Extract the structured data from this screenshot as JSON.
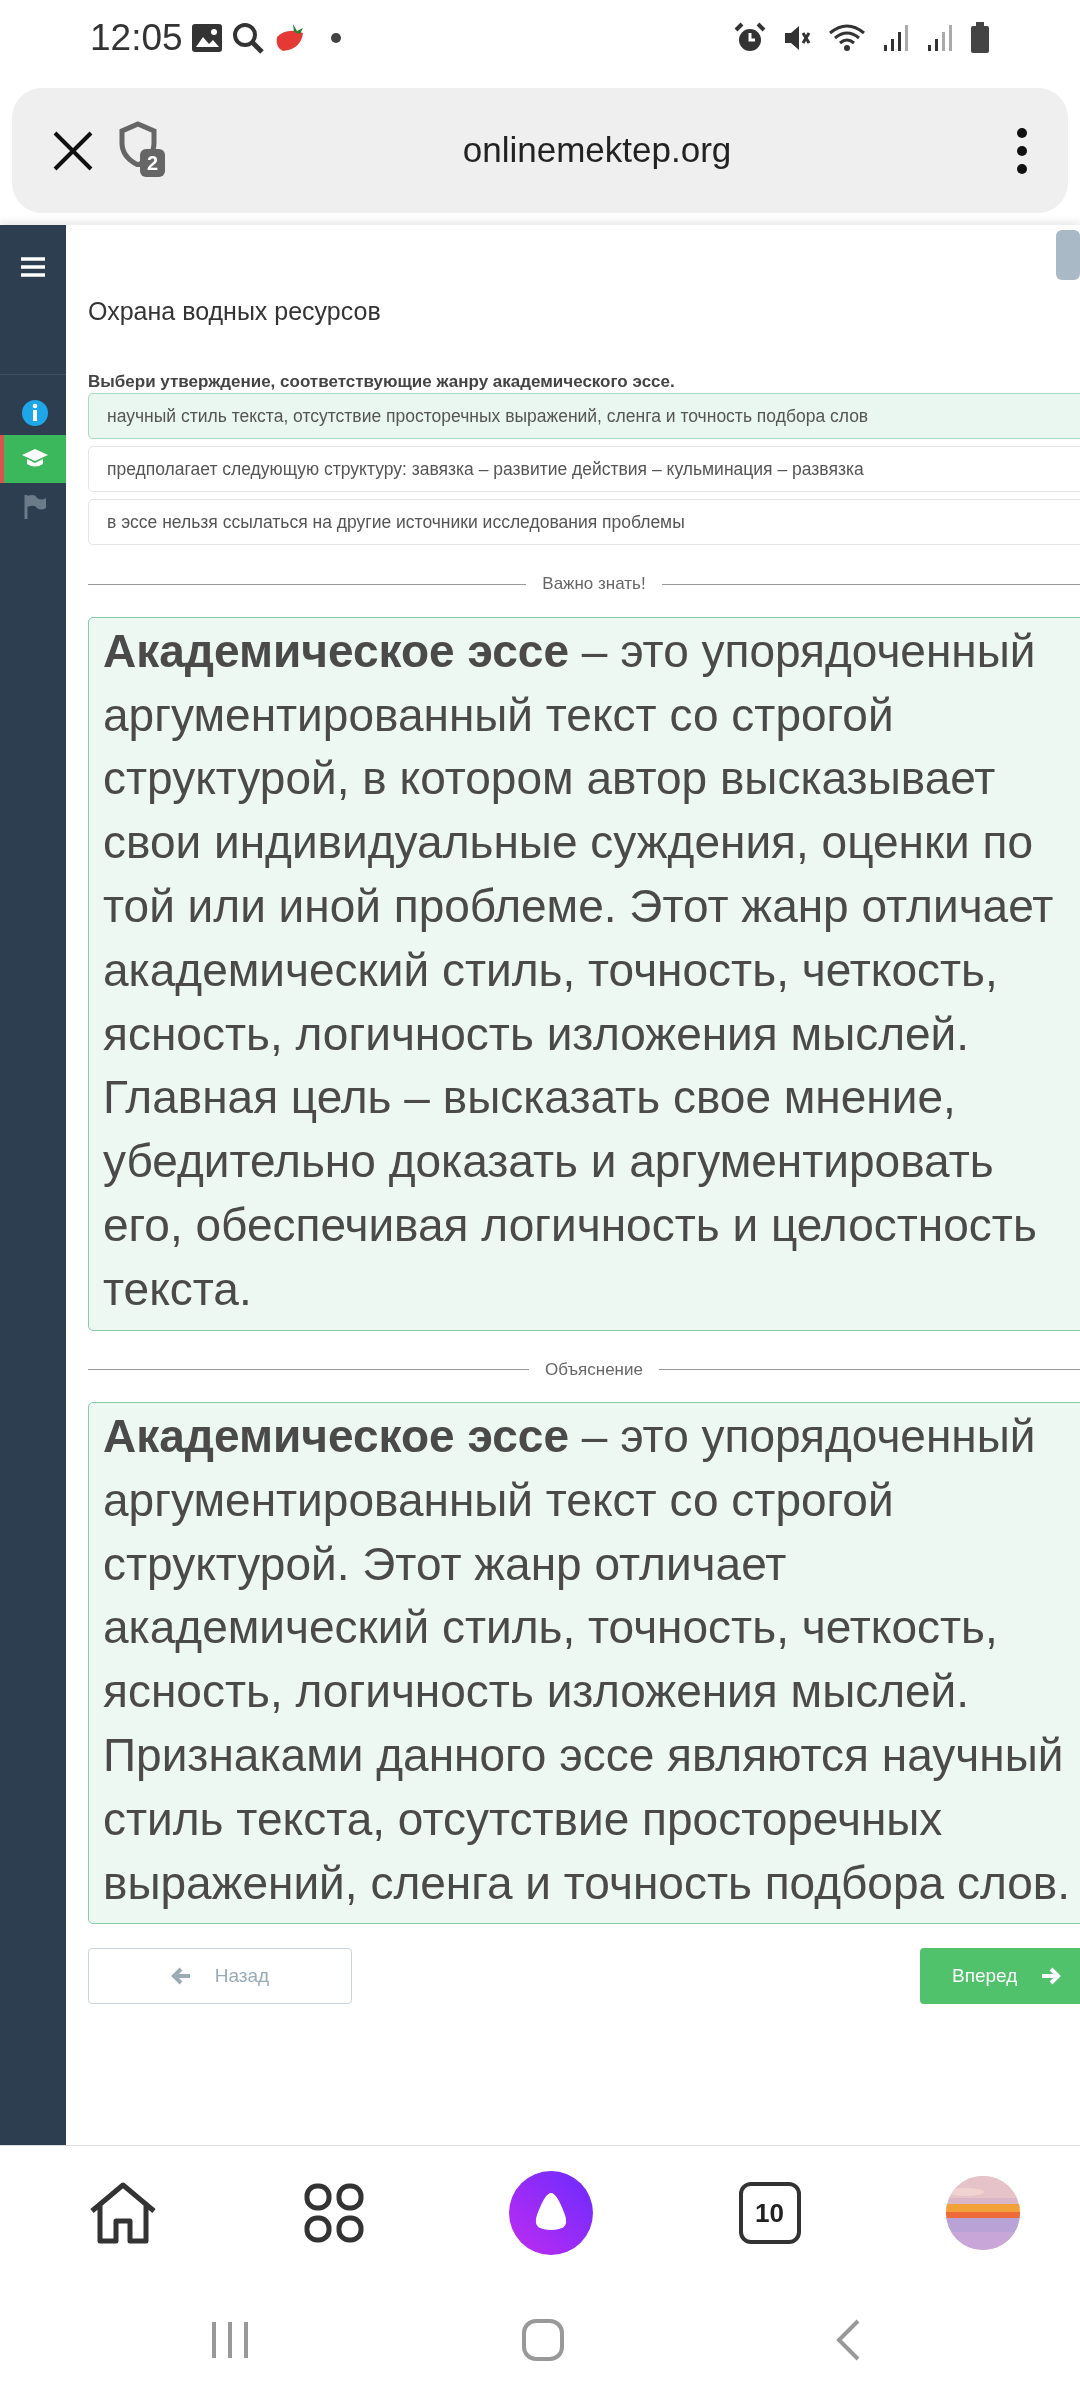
{
  "status_bar": {
    "time": "12:05"
  },
  "browser": {
    "url": "onlinemektep.org",
    "tab_badge": "2"
  },
  "sidebar": {
    "items": [
      {
        "kind": "info",
        "selected": false
      },
      {
        "kind": "course",
        "selected": true
      },
      {
        "kind": "flag",
        "selected": false
      }
    ]
  },
  "lesson": {
    "title": "Охрана водных ресурсов",
    "question": "Выбери утверждение, соответствующие жанру академического эссе.",
    "options": [
      {
        "text": "научный стиль текста, отсутствие просторечных выражений, сленга и точность подбора слов",
        "selected": true
      },
      {
        "text": "предполагает следующую структуру: завязка – развитие действия – кульминация – развязка",
        "selected": false
      },
      {
        "text": "в эссе нельзя ссылаться на другие источники исследования проблемы",
        "selected": false
      }
    ]
  },
  "sections": [
    {
      "heading": "Важно знать!",
      "text": "**Академическое эссе** – это упорядоченный аргументированный текст со строгой структурой, в котором автор высказывает свои индивидуальные суждения, оценки по той или иной проблеме. Этот жанр отличает академический стиль, точность, четкость, ясность, логичность изложения мыслей. Главная цель – высказать свое мнение, убедительно доказать и аргументировать его, обеспечивая логичность и целостность текста."
    },
    {
      "heading": "Объяснение",
      "text": "**Академическое эссе** – это упорядоченный аргументированный текст со строгой структурой. Этот жанр отличает академический стиль, точность, четкость, ясность, логичность изложения мыслей. Признаками данного эссе являются научный стиль текста, отсутствие просторечных выражений, сленга и точность подбора слов."
    }
  ],
  "nav_buttons": {
    "back": "Назад",
    "next": "Вперед"
  },
  "bottom_bar": {
    "tab_count": "10"
  }
}
